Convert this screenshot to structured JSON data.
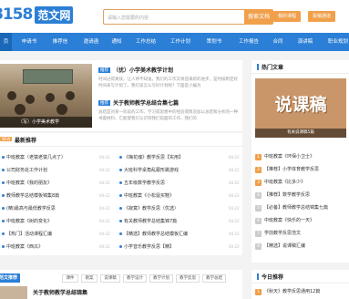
{
  "header": {
    "logo_digits": "8158",
    "logo_text": "范文网",
    "search_placeholder": "请输入您需要的内容",
    "search_button": "搜索文档",
    "login": "我的课程",
    "register": "投稿通道"
  },
  "nav": [
    "页",
    "申请书",
    "推荐信",
    "邀请函",
    "通知",
    "工作总结",
    "工作计划",
    "策划书",
    "工作报告",
    "合同",
    "演讲稿",
    "职业规划"
  ],
  "featured": {
    "photo_caption": "（写）小学美术教学",
    "articles": [
      {
        "tag": "推荐",
        "title": "（优）小学美术教学计划",
        "summary": "时间过得真快，让人神不知鬼，我们的工作又将迎来新的进步，是时候制定好时间表写计划了。我们该怎么写好计划呢？下面是小编为"
      },
      {
        "tag": "推荐",
        "title": "关于教师教学总结合集七篇",
        "summary": "总结是对某一阶段的工作、学习或思想中的经验或情况加以总结和分析的一种书面材料，它能使我们认识到我们前面的工作，我们的"
      }
    ]
  },
  "latest": {
    "badge": "NEW",
    "title": "最新推荐",
    "left": [
      {
        "text": "中班教案（老猿老猿几点了）",
        "date": "04-22"
      },
      {
        "text": "公司财务处工作计划",
        "date": "04-22"
      },
      {
        "text": "中班教案《我的朋友》",
        "date": "04-22"
      },
      {
        "text": "教师教学总结模板锦集8篇",
        "date": "04-22"
      },
      {
        "text": "(精)最高与最低教学反思",
        "date": "04-22"
      },
      {
        "text": "中班教案《树的变化》",
        "date": "04-22"
      },
      {
        "text": "【热门】活动课程汇编",
        "date": "04-22"
      },
      {
        "text": "中班教案《西瓜》",
        "date": "04-22"
      }
    ],
    "right": [
      {
        "text": "《梅花魂》教学反思【实用】",
        "date": "04-22"
      },
      {
        "text": "大班科学桌角乱跟形跳游戏",
        "date": "04-22"
      },
      {
        "text": "五年级数学教学反思",
        "date": "04-22"
      },
      {
        "text": "中班教案《小松鼠买鞋》",
        "date": "04-22"
      },
      {
        "text": "《寂寞》教学反思（优选）",
        "date": "04-22"
      },
      {
        "text": "有关教师教学总结集锦7篇",
        "date": "04-22"
      },
      {
        "text": "【精选】教师教学总结模板汇编",
        "date": "04-22"
      },
      {
        "text": "小学音乐教学反思【精】",
        "date": "04-22"
      }
    ]
  },
  "bottom": {
    "section": "范文推荐",
    "pills": [
      "课件",
      "教案",
      "说课稿",
      "教学设计",
      "教学计划",
      "教学反思",
      "教学总结"
    ],
    "first_article": "关于教师教学总结锦集"
  },
  "sidebar": {
    "title": "热门文章",
    "hot_image_text": "说课稿",
    "hot_caption": "有关说课稿5篇",
    "items": [
      "中班教案《环保小卫士》",
      "【推荐】小学体育教学反思",
      "中班教案《比多少》",
      "【推荐】数学教学反思",
      "【必备】教师教学总结锦集七篇",
      "中班教案《快乐的一天》",
      "学前教学反思范文",
      "【精选】说课稿汇编"
    ],
    "rank_labels": [
      "1",
      "2",
      "3",
      "4",
      "5",
      "6",
      "7",
      "8"
    ],
    "today_title": "今日推荐",
    "today_first": "《秋天》教学反思通用12篇"
  },
  "colors": {
    "brand": "#2b7fd6",
    "accent": "#f0a04b"
  }
}
